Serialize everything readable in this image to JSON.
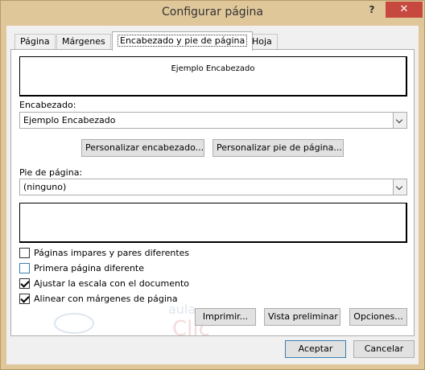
{
  "window": {
    "title": "Configurar página",
    "help_label": "?",
    "close_label": "✕"
  },
  "tabs": [
    {
      "label": "Página"
    },
    {
      "label": "Márgenes"
    },
    {
      "label": "Encabezado y pie de página"
    },
    {
      "label": "Hoja"
    }
  ],
  "header": {
    "preview_text": "Ejemplo Encabezado",
    "label": "Encabezado:",
    "selected": "Ejemplo Encabezado"
  },
  "buttons": {
    "customize_header": "Personalizar encabezado...",
    "customize_footer": "Personalizar pie de página...",
    "print": "Imprimir...",
    "print_preview": "Vista preliminar",
    "options": "Opciones...",
    "accept": "Aceptar",
    "cancel": "Cancelar"
  },
  "footer": {
    "label": "Pie de página:",
    "selected": "(ninguno)",
    "preview_text": ""
  },
  "options": [
    {
      "label": "Páginas impares y pares diferentes",
      "checked": false
    },
    {
      "label": "Primera página diferente",
      "checked": false
    },
    {
      "label": "Ajustar la escala con el documento",
      "checked": true
    },
    {
      "label": "Alinear con márgenes de página",
      "checked": true
    }
  ],
  "watermark": {
    "top": "aula",
    "bottom": "Clic"
  }
}
